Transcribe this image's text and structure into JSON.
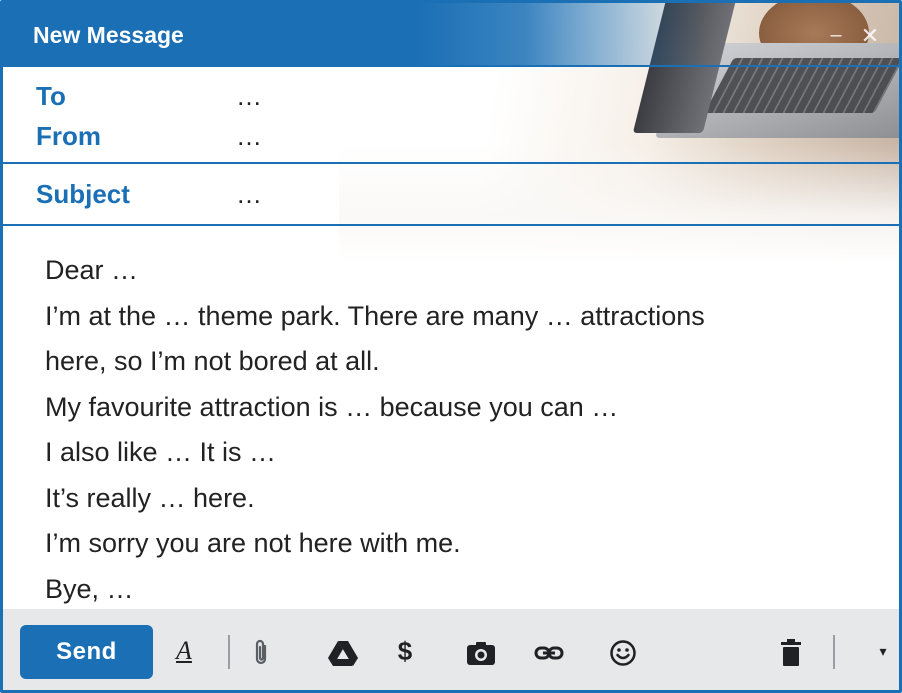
{
  "window": {
    "title": "New Message"
  },
  "fields": {
    "to": {
      "label": "To",
      "value": "…"
    },
    "from": {
      "label": "From",
      "value": "…"
    },
    "subject": {
      "label": "Subject",
      "value": "…"
    }
  },
  "body_lines": [
    "Dear …",
    "I’m at the … theme park. There are many … attractions",
    "here, so I’m not bored at all.",
    "My favourite attraction is … because you can …",
    "I also like …  It is …",
    "It’s really … here.",
    "I’m sorry you are not here with me.",
    "Bye, …"
  ],
  "toolbar": {
    "send_label": "Send",
    "icons": [
      "format-text-icon",
      "attach-icon",
      "drive-icon",
      "money-icon",
      "photo-icon",
      "link-icon",
      "emoji-icon",
      "trash-icon",
      "more-options-icon"
    ]
  },
  "colors": {
    "accent": "#1a6fb5",
    "toolbar_bg": "#e7e8ea",
    "text": "#222222"
  }
}
